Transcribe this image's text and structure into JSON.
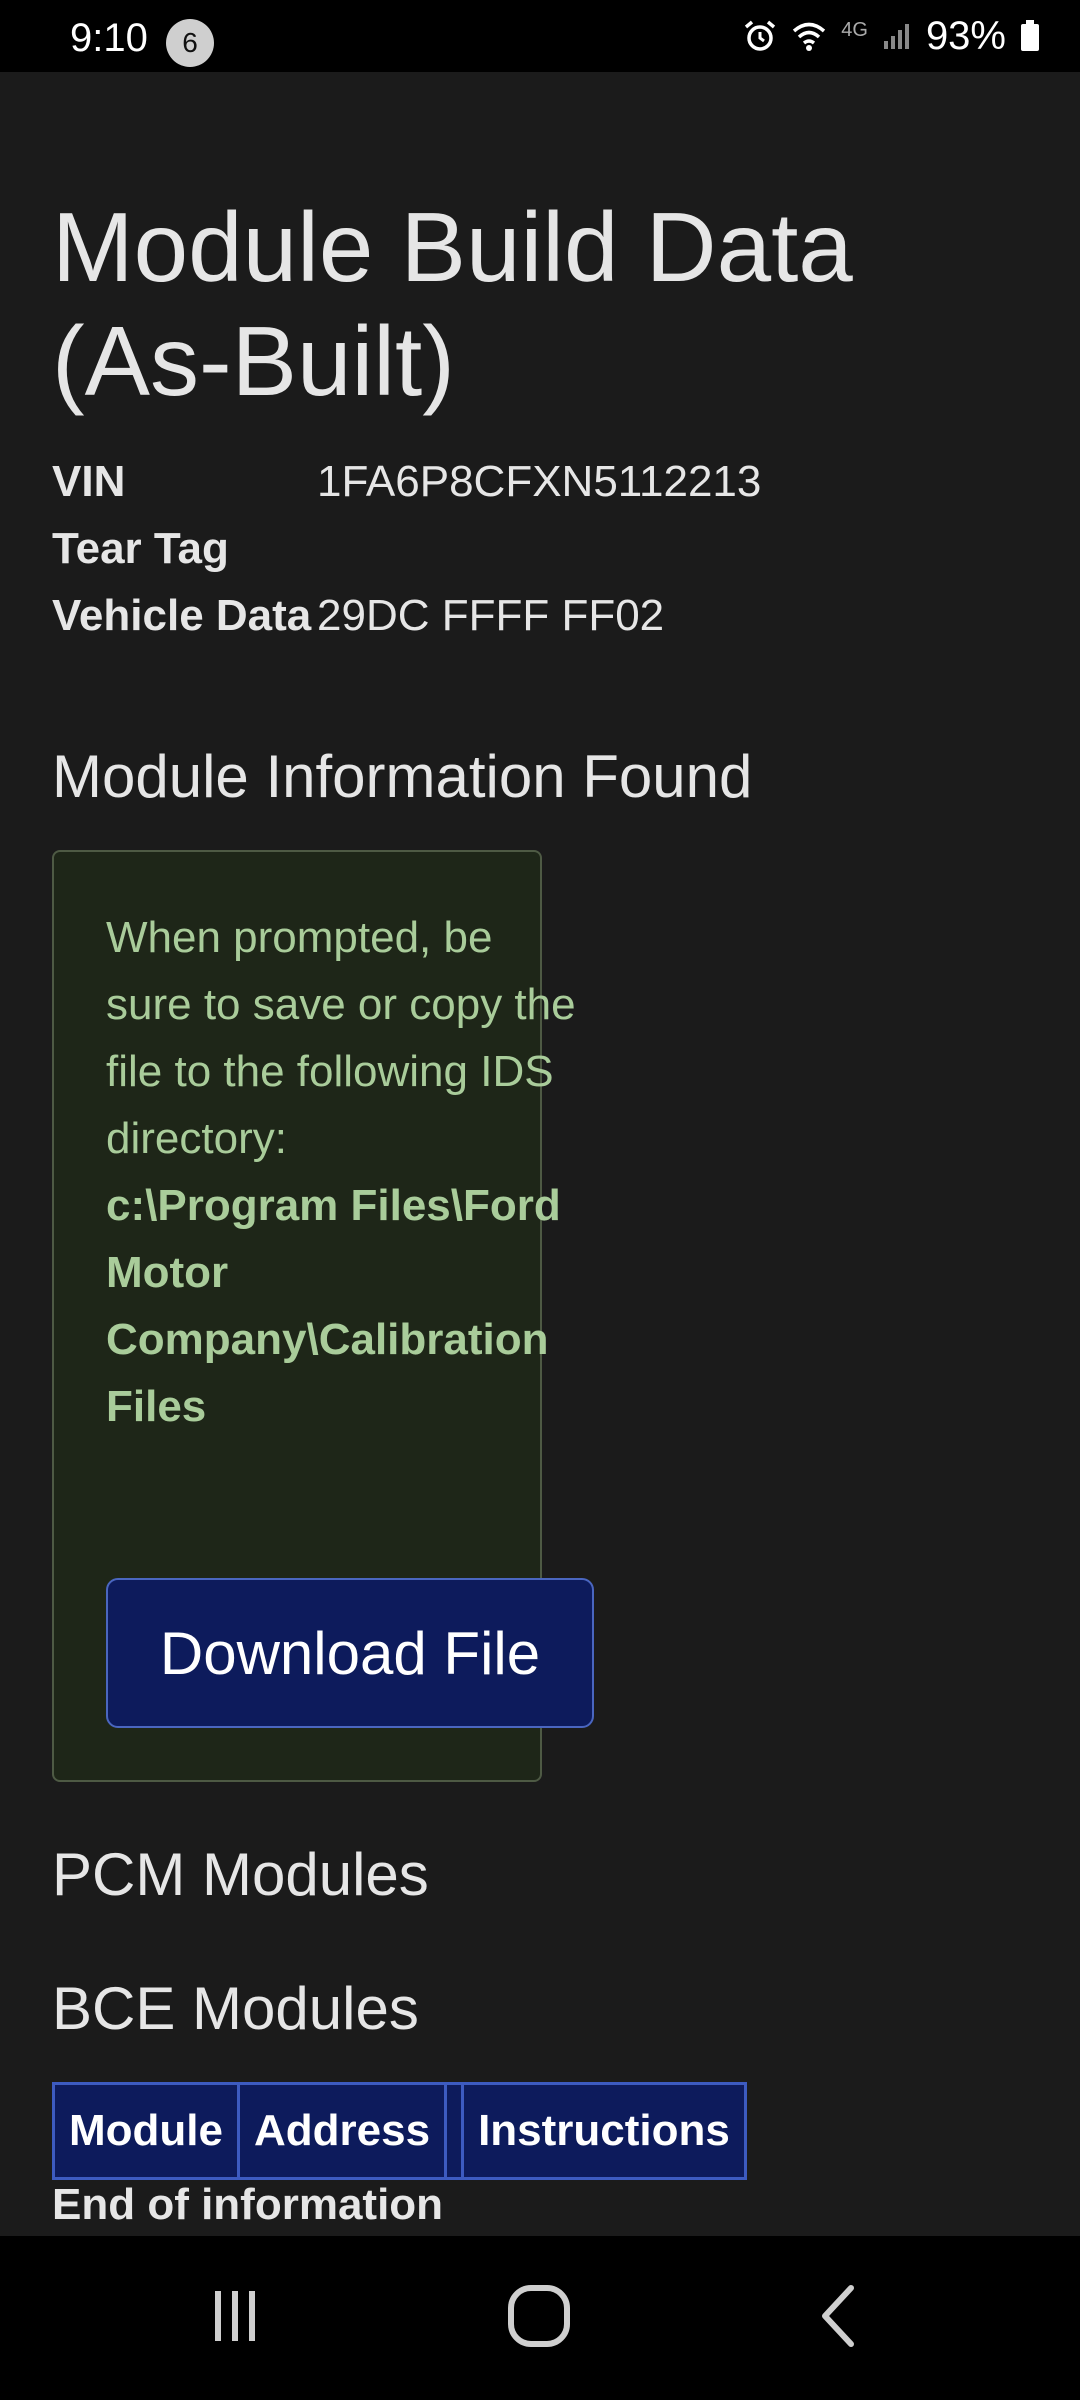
{
  "status": {
    "time": "9:10",
    "notif_count": "6",
    "battery": "93%",
    "net": "4G"
  },
  "page": {
    "title_line1": "Module Build Data",
    "title_line2": "(As-Built)"
  },
  "vehicle_info": [
    {
      "label": "VIN",
      "value": "1FA6P8CFXN5112213"
    },
    {
      "label": "Tear Tag",
      "value": ""
    },
    {
      "label": "Vehicle Data",
      "value": "29DC FFFF FF02"
    }
  ],
  "module_info": {
    "heading": "Module Information Found",
    "notice_text": "When prompted, be sure to save or copy the file to the following IDS directory:",
    "notice_path": "c:\\Program Files\\Ford Motor Company\\Calibration Files",
    "download_label": "Download File"
  },
  "pcm": {
    "heading": "PCM Modules"
  },
  "bce": {
    "heading": "BCE Modules",
    "columns": [
      "Module",
      "Address",
      "",
      "Instructions"
    ]
  },
  "end_text": "End of information"
}
